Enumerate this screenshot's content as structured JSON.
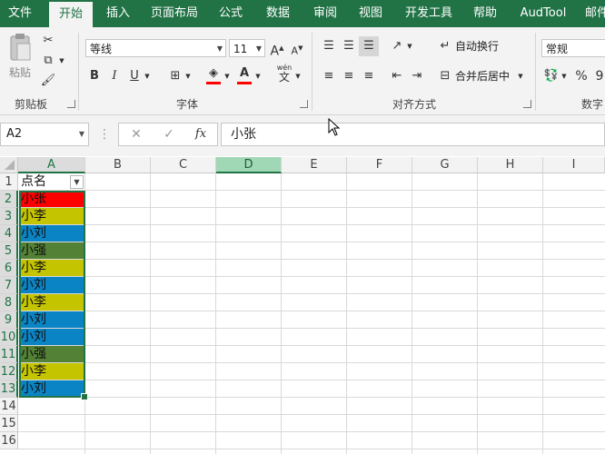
{
  "ribbon_tabs": [
    "文件",
    "开始",
    "插入",
    "页面布局",
    "公式",
    "数据",
    "审阅",
    "视图",
    "开发工具",
    "帮助",
    "AudTool",
    "邮件"
  ],
  "active_tab": "开始",
  "clipboard": {
    "paste_label": "粘贴",
    "group_label": "剪贴板"
  },
  "font": {
    "name": "等线",
    "size": "11",
    "grow": "A",
    "shrink": "A",
    "bold": "B",
    "italic": "I",
    "underline": "U",
    "wen": "wén",
    "wen_char": "文",
    "font_color_letter": "A",
    "group_label": "字体"
  },
  "alignment": {
    "wrap_text": "自动换行",
    "merge_center": "合并后居中",
    "group_label": "对齐方式"
  },
  "number": {
    "format": "常规",
    "percent": "%",
    "comma": "9",
    "group_label": "数字"
  },
  "formula_bar": {
    "name_box": "A2",
    "cancel": "✕",
    "enter": "✓",
    "fx": "fx",
    "content": "小张"
  },
  "columns": [
    "A",
    "B",
    "C",
    "D",
    "E",
    "F",
    "G",
    "H",
    "I"
  ],
  "rows": [
    "1",
    "2",
    "3",
    "4",
    "5",
    "6",
    "7",
    "8",
    "9",
    "10",
    "11",
    "12",
    "13",
    "14",
    "15",
    "16"
  ],
  "colors": {
    "red": "#ff0000",
    "yellow": "#c4c400",
    "blue": "#0a84c4",
    "green": "#538135",
    "excel_green": "#217346"
  },
  "column_a_cells": [
    {
      "text": "点名",
      "color": ""
    },
    {
      "text": "小张",
      "color": "#ff0000"
    },
    {
      "text": "小李",
      "color": "#c4c400"
    },
    {
      "text": "小刘",
      "color": "#0a84c4"
    },
    {
      "text": "小强",
      "color": "#538135"
    },
    {
      "text": "小李",
      "color": "#c4c400"
    },
    {
      "text": "小刘",
      "color": "#0a84c4"
    },
    {
      "text": "小李",
      "color": "#c4c400"
    },
    {
      "text": "小刘",
      "color": "#0a84c4"
    },
    {
      "text": "小刘",
      "color": "#0a84c4"
    },
    {
      "text": "小强",
      "color": "#538135"
    },
    {
      "text": "小李",
      "color": "#c4c400"
    },
    {
      "text": "小刘",
      "color": "#0a84c4"
    }
  ]
}
